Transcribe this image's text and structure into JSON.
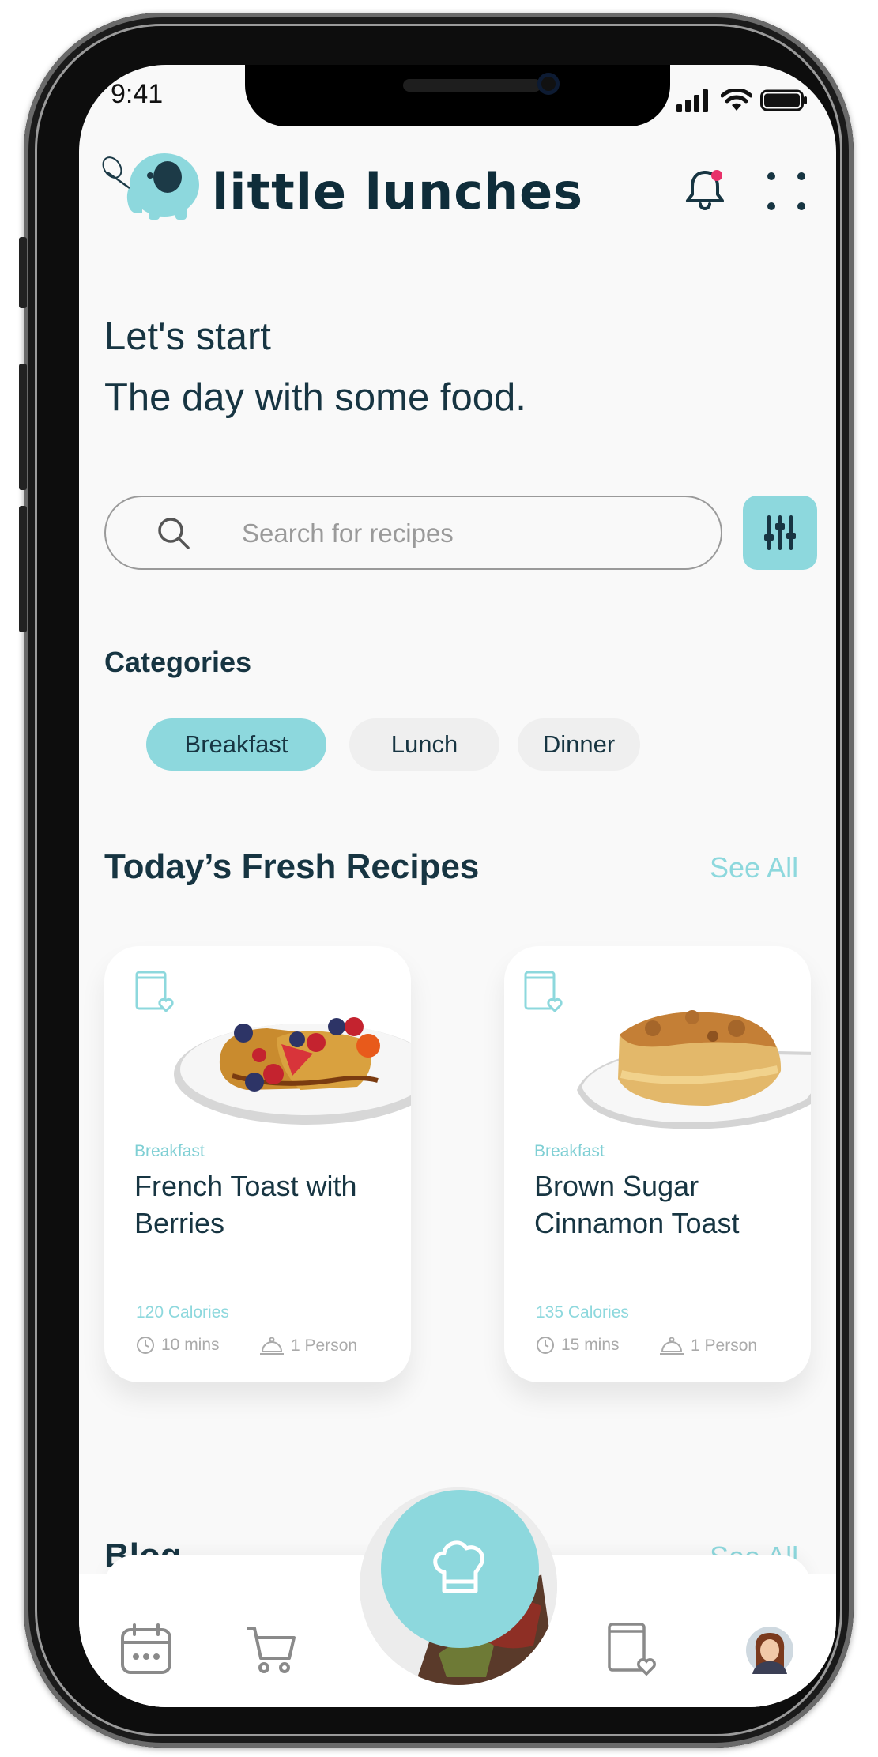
{
  "status_bar": {
    "time": "9:41"
  },
  "header": {
    "app_name": "little lunches"
  },
  "greeting": {
    "line1": "Let's start",
    "line2": "The day with some food."
  },
  "search": {
    "placeholder": "Search for recipes"
  },
  "categories": {
    "title": "Categories",
    "items": [
      {
        "label": "Breakfast",
        "selected": true
      },
      {
        "label": "Lunch",
        "selected": false
      },
      {
        "label": "Dinner",
        "selected": false
      }
    ]
  },
  "recipes_section": {
    "title": "Today’s Fresh Recipes",
    "see_all": "See All"
  },
  "recipes": [
    {
      "category": "Breakfast",
      "title": "French Toast with Berries",
      "calories": "120 Calories",
      "time": "10 mins",
      "serving": "1 Person",
      "image": "french-toast-plate"
    },
    {
      "category": "Breakfast",
      "title": "Brown Sugar Cinnamon Toast",
      "calories": "135 Calories",
      "time": "15 mins",
      "serving": "1 Person",
      "image": "cinnamon-toast-plate"
    }
  ],
  "blog_section": {
    "title": "Blog",
    "see_all": "See All"
  },
  "tab_bar": {
    "items": [
      "calendar-icon",
      "cart-icon",
      "chef-hat-icon",
      "saved-recipes-icon",
      "profile-avatar"
    ]
  },
  "colors": {
    "accent": "#8dd8dd",
    "text_dark": "#173542",
    "notification_dot": "#e8316a",
    "chip_inactive": "#efefef"
  }
}
